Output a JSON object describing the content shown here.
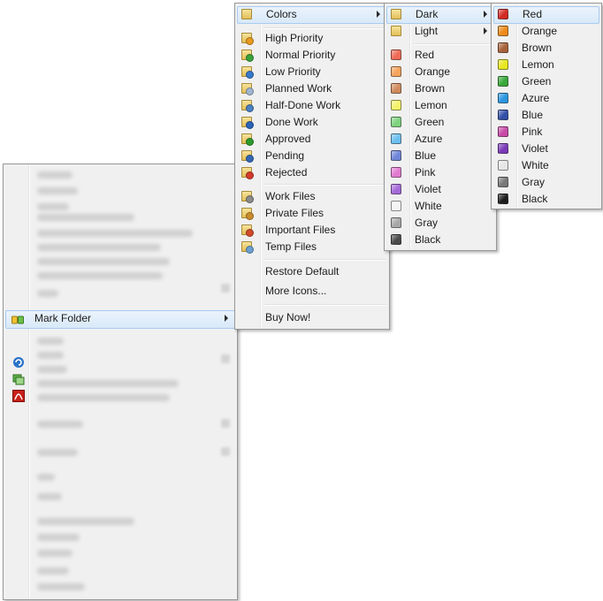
{
  "context_menu": {
    "mark_folder_label": "Mark Folder"
  },
  "main_submenu": {
    "colors_label": "Colors",
    "priority_items": [
      {
        "label": "High Priority",
        "icon": "high-priority-icon",
        "badge": "#e89a1e"
      },
      {
        "label": "Normal Priority",
        "icon": "normal-priority-icon",
        "badge": "#39a23a"
      },
      {
        "label": "Low Priority",
        "icon": "low-priority-icon",
        "badge": "#3478c9"
      },
      {
        "label": "Planned Work",
        "icon": "planned-work-icon",
        "badge": "#9fb6d0"
      },
      {
        "label": "Half-Done Work",
        "icon": "half-done-work-icon",
        "badge": "#4a7fc0"
      },
      {
        "label": "Done Work",
        "icon": "done-work-icon",
        "badge": "#2a63b8"
      },
      {
        "label": "Approved",
        "icon": "approved-icon",
        "badge": "#2d9a2d"
      },
      {
        "label": "Pending",
        "icon": "pending-icon",
        "badge": "#3367b5"
      },
      {
        "label": "Rejected",
        "icon": "rejected-icon",
        "badge": "#d23a2a"
      }
    ],
    "file_items": [
      {
        "label": "Work Files",
        "icon": "work-files-icon",
        "badge": "#8a8a8a"
      },
      {
        "label": "Private Files",
        "icon": "private-files-icon",
        "badge": "#c88b2a"
      },
      {
        "label": "Important Files",
        "icon": "important-files-icon",
        "badge": "#d14a2a"
      },
      {
        "label": "Temp Files",
        "icon": "temp-files-icon",
        "badge": "#6aa0d0"
      }
    ],
    "restore_label": "Restore Default",
    "more_icons_label": "More Icons...",
    "buy_label": "Buy Now!"
  },
  "colors_submenu": {
    "dark_label": "Dark",
    "light_label": "Light",
    "light_colors": [
      {
        "label": "Red",
        "color": "#ef6a55"
      },
      {
        "label": "Orange",
        "color": "#f5a35a"
      },
      {
        "label": "Brown",
        "color": "#d08a5c"
      },
      {
        "label": "Lemon",
        "color": "#f4f26a"
      },
      {
        "label": "Green",
        "color": "#7ed37e"
      },
      {
        "label": "Azure",
        "color": "#6cbff0"
      },
      {
        "label": "Blue",
        "color": "#6f86d8"
      },
      {
        "label": "Pink",
        "color": "#e27ad0"
      },
      {
        "label": "Violet",
        "color": "#a46ad8"
      },
      {
        "label": "White",
        "color": "#f4f4f4"
      },
      {
        "label": "Gray",
        "color": "#a8a8a8"
      },
      {
        "label": "Black",
        "color": "#4a4a4a"
      }
    ]
  },
  "dark_submenu": {
    "colors": [
      {
        "label": "Red",
        "color": "#d42a24"
      },
      {
        "label": "Orange",
        "color": "#ef8a1a"
      },
      {
        "label": "Brown",
        "color": "#a8623a"
      },
      {
        "label": "Lemon",
        "color": "#e8e820"
      },
      {
        "label": "Green",
        "color": "#38a838"
      },
      {
        "label": "Azure",
        "color": "#2a96e0"
      },
      {
        "label": "Blue",
        "color": "#3250a8"
      },
      {
        "label": "Pink",
        "color": "#c84aa8"
      },
      {
        "label": "Violet",
        "color": "#7a3ab8"
      },
      {
        "label": "White",
        "color": "#e6e6e6"
      },
      {
        "label": "Gray",
        "color": "#787878"
      },
      {
        "label": "Black",
        "color": "#1e1e1e"
      }
    ]
  }
}
